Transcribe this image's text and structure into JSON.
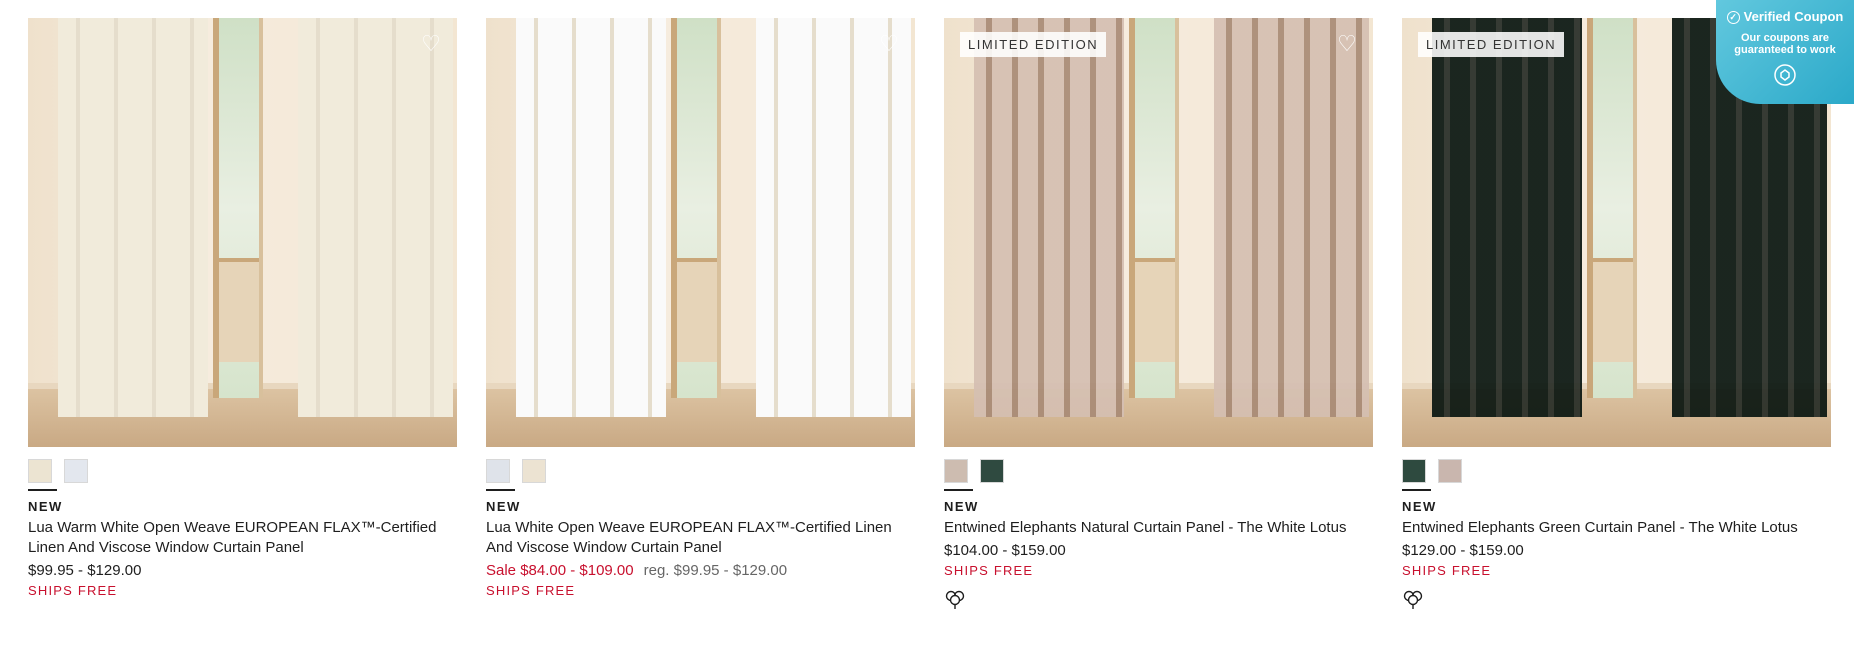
{
  "coupon": {
    "title": "Verified Coupon",
    "subtitle": "Our coupons are guaranteed to work"
  },
  "products": [
    {
      "badge": "",
      "swatches": [
        "#ece4d2",
        "#e3e7ee"
      ],
      "curtain_color": "#f1ebdb",
      "new_label": "NEW",
      "name": "Lua Warm White Open Weave EUROPEAN FLAX™-Certified Linen And Viscose Window Curtain Panel",
      "price": "$99.95 - $129.00",
      "sale_price": "",
      "reg_price": "",
      "shipping": "SHIPS FREE",
      "eco_icon": false
    },
    {
      "badge": "",
      "swatches": [
        "#dfe3ea",
        "#ece3d2"
      ],
      "curtain_color": "#fafafa",
      "new_label": "NEW",
      "name": "Lua White Open Weave EUROPEAN FLAX™-Certified Linen And Viscose Window Curtain Panel",
      "price": "",
      "sale_price": "Sale $84.00 - $109.00",
      "reg_price": "reg. $99.95 - $129.00",
      "shipping": "SHIPS FREE",
      "eco_icon": false
    },
    {
      "badge": "LIMITED EDITION",
      "swatches": [
        "#cdbcb0",
        "#2f4a40"
      ],
      "curtain_color": "#e9ddd5",
      "new_label": "NEW",
      "name": "Entwined Elephants Natural Curtain Panel - The White Lotus",
      "price": "$104.00 - $159.00",
      "sale_price": "",
      "reg_price": "",
      "shipping": "SHIPS FREE",
      "eco_icon": true
    },
    {
      "badge": "LIMITED EDITION",
      "swatches": [
        "#2e4a3f",
        "#c9b6ae"
      ],
      "curtain_color": "#2f4a40",
      "new_label": "NEW",
      "name": "Entwined Elephants Green Curtain Panel - The White Lotus",
      "price": "$129.00 - $159.00",
      "sale_price": "",
      "reg_price": "",
      "shipping": "SHIPS FREE",
      "eco_icon": true
    }
  ]
}
